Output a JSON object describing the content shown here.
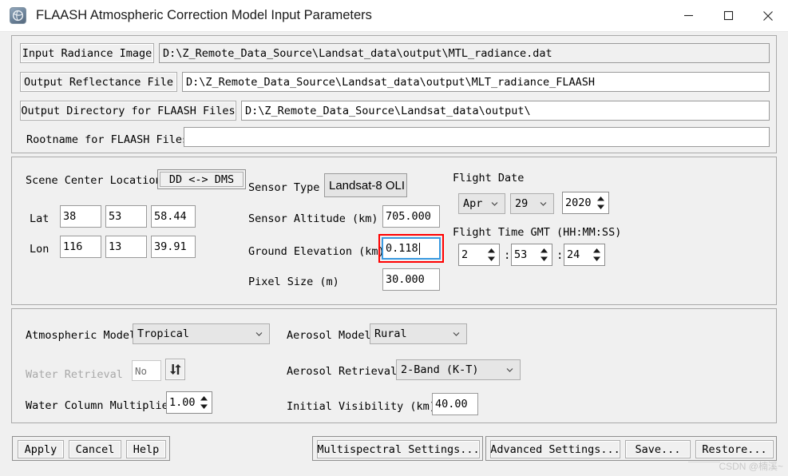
{
  "window": {
    "title": "FLAASH Atmospheric Correction Model Input Parameters",
    "icon": "envi-globe-icon",
    "controls": {
      "minimize": "minimize-icon",
      "maximize": "maximize-icon",
      "close": "close-icon"
    }
  },
  "files": {
    "input_radiance_label": "Input Radiance Image",
    "input_radiance_value": "D:\\Z_Remote_Data_Source\\Landsat_data\\output\\MTL_radiance.dat",
    "output_reflectance_label": "Output Reflectance File",
    "output_reflectance_value": "D:\\Z_Remote_Data_Source\\Landsat_data\\output\\MLT_radiance_FLAASH",
    "output_directory_label": "Output Directory for FLAASH Files",
    "output_directory_value": "D:\\Z_Remote_Data_Source\\Landsat_data\\output\\",
    "rootname_label": "Rootname for FLAASH Files",
    "rootname_value": ""
  },
  "scene": {
    "center_location_label": "Scene Center Location",
    "dd_dms_button": "DD <-> DMS",
    "lat_label": "Lat",
    "lat_deg": "38",
    "lat_min": "53",
    "lat_sec": "58.44",
    "lon_label": "Lon",
    "lon_deg": "116",
    "lon_min": "13",
    "lon_sec": "39.91"
  },
  "sensor": {
    "type_label": "Sensor Type",
    "type_value": "Landsat-8 OLI",
    "altitude_label": "Sensor Altitude (km)",
    "altitude_value": "705.000",
    "ground_elevation_label": "Ground Elevation (km)",
    "ground_elevation_value": "0.118",
    "pixel_size_label": "Pixel Size (m)",
    "pixel_size_value": "30.000"
  },
  "flight": {
    "date_label": "Flight Date",
    "month": "Apr",
    "day": "29",
    "year": "2020",
    "time_label": "Flight Time GMT (HH:MM:SS)",
    "hour": "2",
    "minute": "53",
    "second": "24",
    "separator": ":"
  },
  "models": {
    "atmospheric_model_label": "Atmospheric Model",
    "atmospheric_model_value": "Tropical",
    "water_retrieval_label": "Water Retrieval",
    "water_retrieval_value": "No",
    "water_column_label": "Water Column Multiplier",
    "water_column_value": "1.00",
    "aerosol_model_label": "Aerosol Model",
    "aerosol_model_value": "Rural",
    "aerosol_retrieval_label": "Aerosol Retrieval",
    "aerosol_retrieval_value": "2-Band (K-T)",
    "initial_visibility_label": "Initial Visibility (km)",
    "initial_visibility_value": "40.00"
  },
  "actions": {
    "apply": "Apply",
    "cancel": "Cancel",
    "help": "Help",
    "multispectral_settings": "Multispectral Settings...",
    "advanced_settings": "Advanced Settings...",
    "save": "Save...",
    "restore": "Restore..."
  },
  "watermark": {
    "text": "CSDN @楠溪~"
  },
  "colors": {
    "accent_focus": "#3a9ae0",
    "annotation": "#ff0000",
    "panel_bg": "#f0f0f0",
    "field_bg": "#ffffff"
  }
}
